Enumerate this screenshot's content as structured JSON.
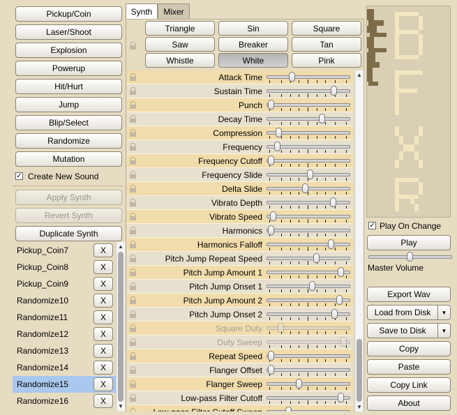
{
  "generators": [
    "Pickup/Coin",
    "Laser/Shoot",
    "Explosion",
    "Powerup",
    "Hit/Hurt",
    "Jump",
    "Blip/Select",
    "Randomize",
    "Mutation"
  ],
  "create_new_sound": {
    "label": "Create New Sound",
    "checked": true
  },
  "actions": {
    "apply": "Apply Synth",
    "revert": "Revert Synth",
    "duplicate": "Duplicate Synth"
  },
  "sound_list": {
    "items": [
      "Pickup_Coin7",
      "Pickup_Coin8",
      "Pickup_Coin9",
      "Randomize10",
      "Randomize11",
      "Randomize12",
      "Randomize13",
      "Randomize14",
      "Randomize15",
      "Randomize16"
    ],
    "selected": "Randomize15",
    "delete_label": "X"
  },
  "tabs": {
    "synth": "Synth",
    "mixer": "Mixer",
    "active": "Synth"
  },
  "waveforms": [
    "Triangle",
    "Sin",
    "Square",
    "Saw",
    "Breaker",
    "Tan",
    "Whistle",
    "White",
    "Pink"
  ],
  "selected_waveform": "White",
  "params": [
    {
      "name": "Attack Time",
      "value": 0.28
    },
    {
      "name": "Sustain Time",
      "value": 0.83
    },
    {
      "name": "Punch",
      "value": 0.0
    },
    {
      "name": "Decay Time",
      "value": 0.68
    },
    {
      "name": "Compression",
      "value": 0.1
    },
    {
      "name": "Frequency",
      "value": 0.08
    },
    {
      "name": "Frequency Cutoff",
      "value": 0.0
    },
    {
      "name": "Frequency Slide",
      "value": 0.52
    },
    {
      "name": "Delta Slide",
      "value": 0.45
    },
    {
      "name": "Vibrato Depth",
      "value": 0.82
    },
    {
      "name": "Vibrato Speed",
      "value": 0.03
    },
    {
      "name": "Harmonics",
      "value": 0.0
    },
    {
      "name": "Harmonics Falloff",
      "value": 0.8
    },
    {
      "name": "Pitch Jump Repeat Speed",
      "value": 0.6
    },
    {
      "name": "Pitch Jump Amount 1",
      "value": 0.93
    },
    {
      "name": "Pitch Jump Onset 1",
      "value": 0.55
    },
    {
      "name": "Pitch Jump Amount 2",
      "value": 0.91
    },
    {
      "name": "Pitch Jump Onset 2",
      "value": 0.84
    },
    {
      "name": "Square Duty",
      "value": 0.13,
      "disabled": true
    },
    {
      "name": "Duty Sweep",
      "value": 0.96,
      "disabled": true
    },
    {
      "name": "Repeat Speed",
      "value": 0.0
    },
    {
      "name": "Flanger Offset",
      "value": 0.0
    },
    {
      "name": "Flanger Sweep",
      "value": 0.37
    },
    {
      "name": "Low-pass Filter Cutoff",
      "value": 0.93
    },
    {
      "name": "Low-pass Filter Cutoff Sweep",
      "value": 0.23
    }
  ],
  "play_on_change": {
    "label": "Play On Change",
    "checked": true
  },
  "play": "Play",
  "master_volume": {
    "label": "Master Volume",
    "value": 0.5
  },
  "export": {
    "wav": "Export Wav",
    "load": "Load from Disk",
    "save": "Save to Disk",
    "copy": "Copy",
    "paste": "Paste",
    "copy_link": "Copy Link",
    "about": "About"
  },
  "colors": {
    "background": "#e6dcc2",
    "row_odd": "#f1dcab",
    "row_even": "#e8e0ce",
    "selection": "#a9c8ee",
    "logo_light": "#f2e6c0",
    "logo_dark": "#7e6b48"
  }
}
